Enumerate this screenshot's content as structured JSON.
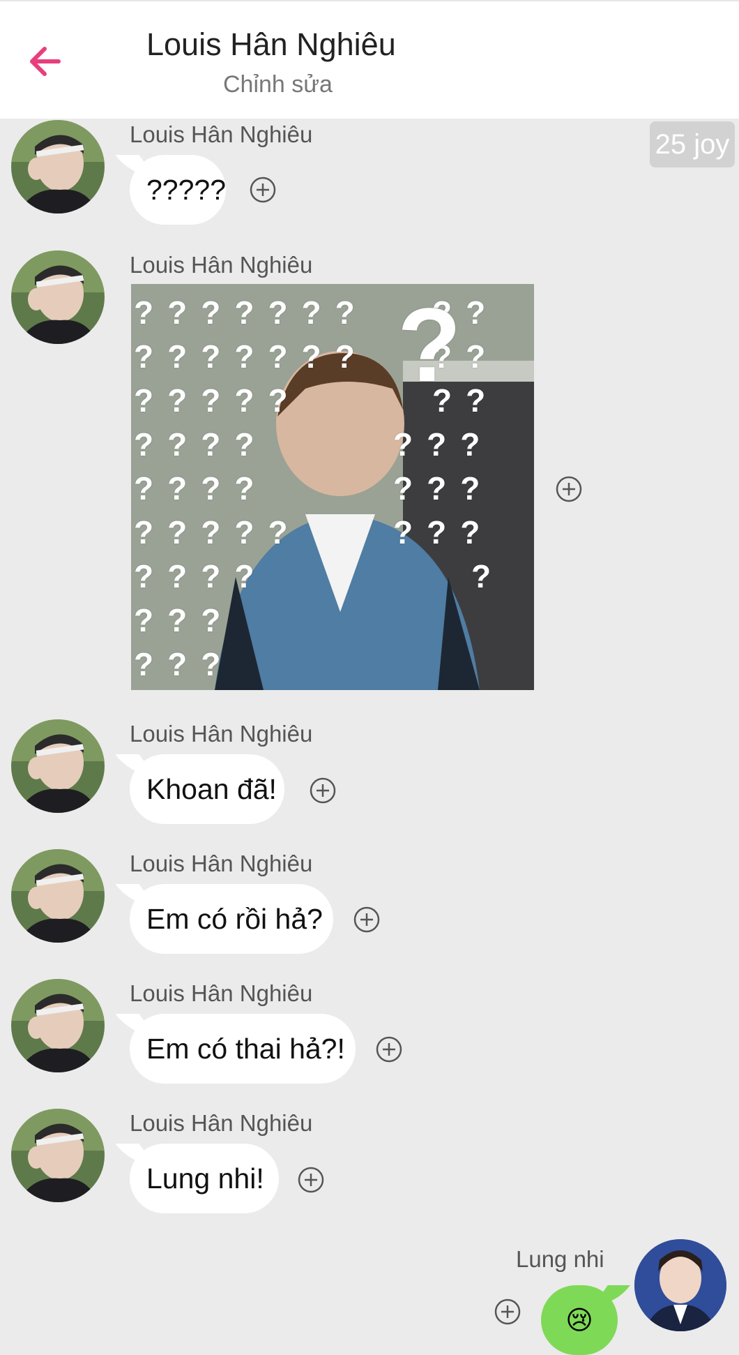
{
  "header": {
    "title": "Louis Hân Nghiêu",
    "subtitle": "Chỉnh sửa",
    "accent_color": "#e83e7c"
  },
  "badge": {
    "text": "25 joy"
  },
  "messages": [
    {
      "sender": "Louis Hân Nghiêu",
      "text": "?????"
    },
    {
      "sender": "Louis Hân Nghiêu",
      "image": "question-marks-photo"
    },
    {
      "sender": "Louis Hân Nghiêu",
      "text": "Khoan đã!"
    },
    {
      "sender": "Louis Hân Nghiêu",
      "text": "Em có rồi hả?"
    },
    {
      "sender": "Louis Hân Nghiêu",
      "text": "Em có thai hả?!"
    },
    {
      "sender": "Louis Hân Nghiêu",
      "text": "Lung nhi!"
    }
  ],
  "photo_text": {
    "small_mark": "?",
    "big_mark": "?"
  },
  "my_message": {
    "sender": "Lung nhi",
    "emoji": "😢",
    "bubble_color": "#7ed957"
  }
}
